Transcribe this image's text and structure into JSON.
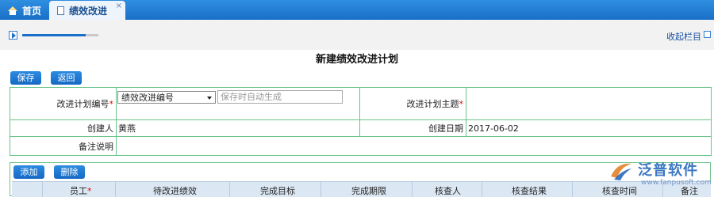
{
  "tabs": {
    "home": "首页",
    "active": "绩效改进",
    "close": "×"
  },
  "toolbar": {
    "collapse": "收起栏目",
    "progress": 0.83
  },
  "page": {
    "title": "新建绩效改进计划"
  },
  "buttons": {
    "save": "保存",
    "back": "返回",
    "add": "添加",
    "delete": "删除"
  },
  "form": {
    "plan_no_label": "改进计划编号",
    "plan_no_select": "绩效改进编号",
    "plan_no_placeholder": "保存时自动生成",
    "plan_subject_label": "改进计划主题",
    "creator_label": "创建人",
    "creator_value": "黄燕",
    "create_date_label": "创建日期",
    "create_date_value": "2017-06-02",
    "remark_label": "备注说明",
    "required_mark": "*"
  },
  "grid": {
    "headers": [
      "员工",
      "待改进绩效",
      "完成目标",
      "完成期限",
      "核查人",
      "核查结果",
      "核查时间",
      "备注"
    ]
  },
  "watermark": {
    "brand": "泛普软件",
    "url": "www.fanpusoft.com"
  },
  "colors": {
    "tab_bar": "#1a6fc8",
    "button": "#1a6fc8",
    "border_green": "#6bc38a",
    "required": "#e00000"
  }
}
